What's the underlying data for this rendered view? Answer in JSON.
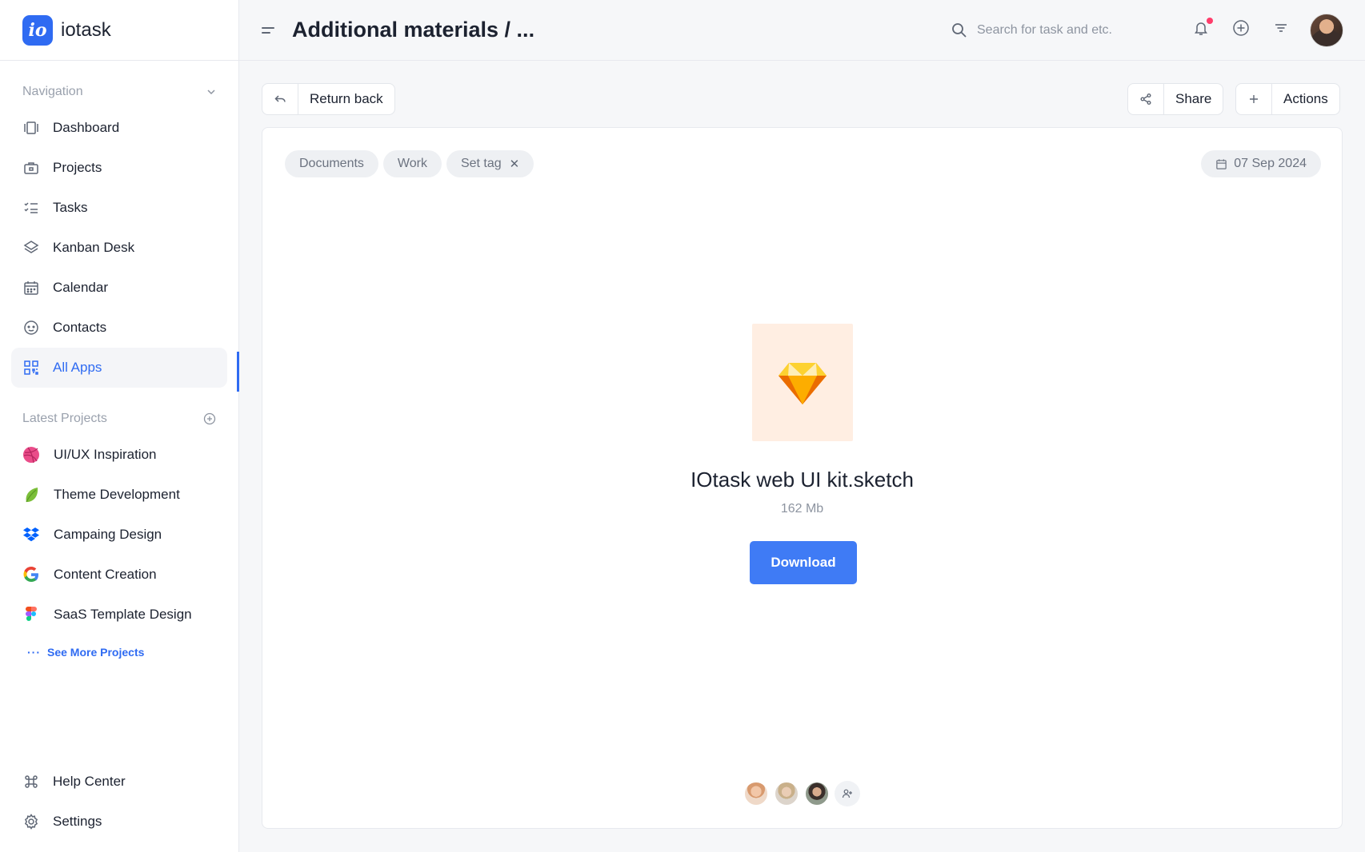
{
  "brand": {
    "logo_text": "io",
    "name": "iotask",
    "accent": "#2f6bf2"
  },
  "sidebar": {
    "nav_heading": "Navigation",
    "nav_items": [
      {
        "label": "Dashboard",
        "icon": "dashboard-icon"
      },
      {
        "label": "Projects",
        "icon": "briefcase-icon"
      },
      {
        "label": "Tasks",
        "icon": "checklist-icon"
      },
      {
        "label": "Kanban Desk",
        "icon": "layers-icon"
      },
      {
        "label": "Calendar",
        "icon": "calendar-icon"
      },
      {
        "label": "Contacts",
        "icon": "smile-icon"
      },
      {
        "label": "All Apps",
        "icon": "apps-grid-icon",
        "active": true
      }
    ],
    "projects_heading": "Latest Projects",
    "projects": [
      {
        "label": "UI/UX Inspiration",
        "icon": "dribbble-icon"
      },
      {
        "label": "Theme Development",
        "icon": "leaf-icon"
      },
      {
        "label": "Campaing Design",
        "icon": "dropbox-icon"
      },
      {
        "label": "Content Creation",
        "icon": "google-icon"
      },
      {
        "label": "SaaS Template Design",
        "icon": "figma-icon"
      }
    ],
    "see_more_dots": "···",
    "see_more": "See More Projects",
    "bottom_items": [
      {
        "label": "Help Center",
        "icon": "command-icon"
      },
      {
        "label": "Settings",
        "icon": "gear-icon"
      }
    ]
  },
  "header": {
    "title": "Additional materials / ...",
    "search_placeholder": "Search for task and etc."
  },
  "toolbar": {
    "return_label": "Return back",
    "share_label": "Share",
    "actions_label": "Actions"
  },
  "file": {
    "tags": [
      "Documents",
      "Work",
      "Set tag"
    ],
    "tag_remove": "✕",
    "date": "07 Sep 2024",
    "name": "IOtask web UI kit.sketch",
    "size": "162 Mb",
    "download_label": "Download"
  }
}
